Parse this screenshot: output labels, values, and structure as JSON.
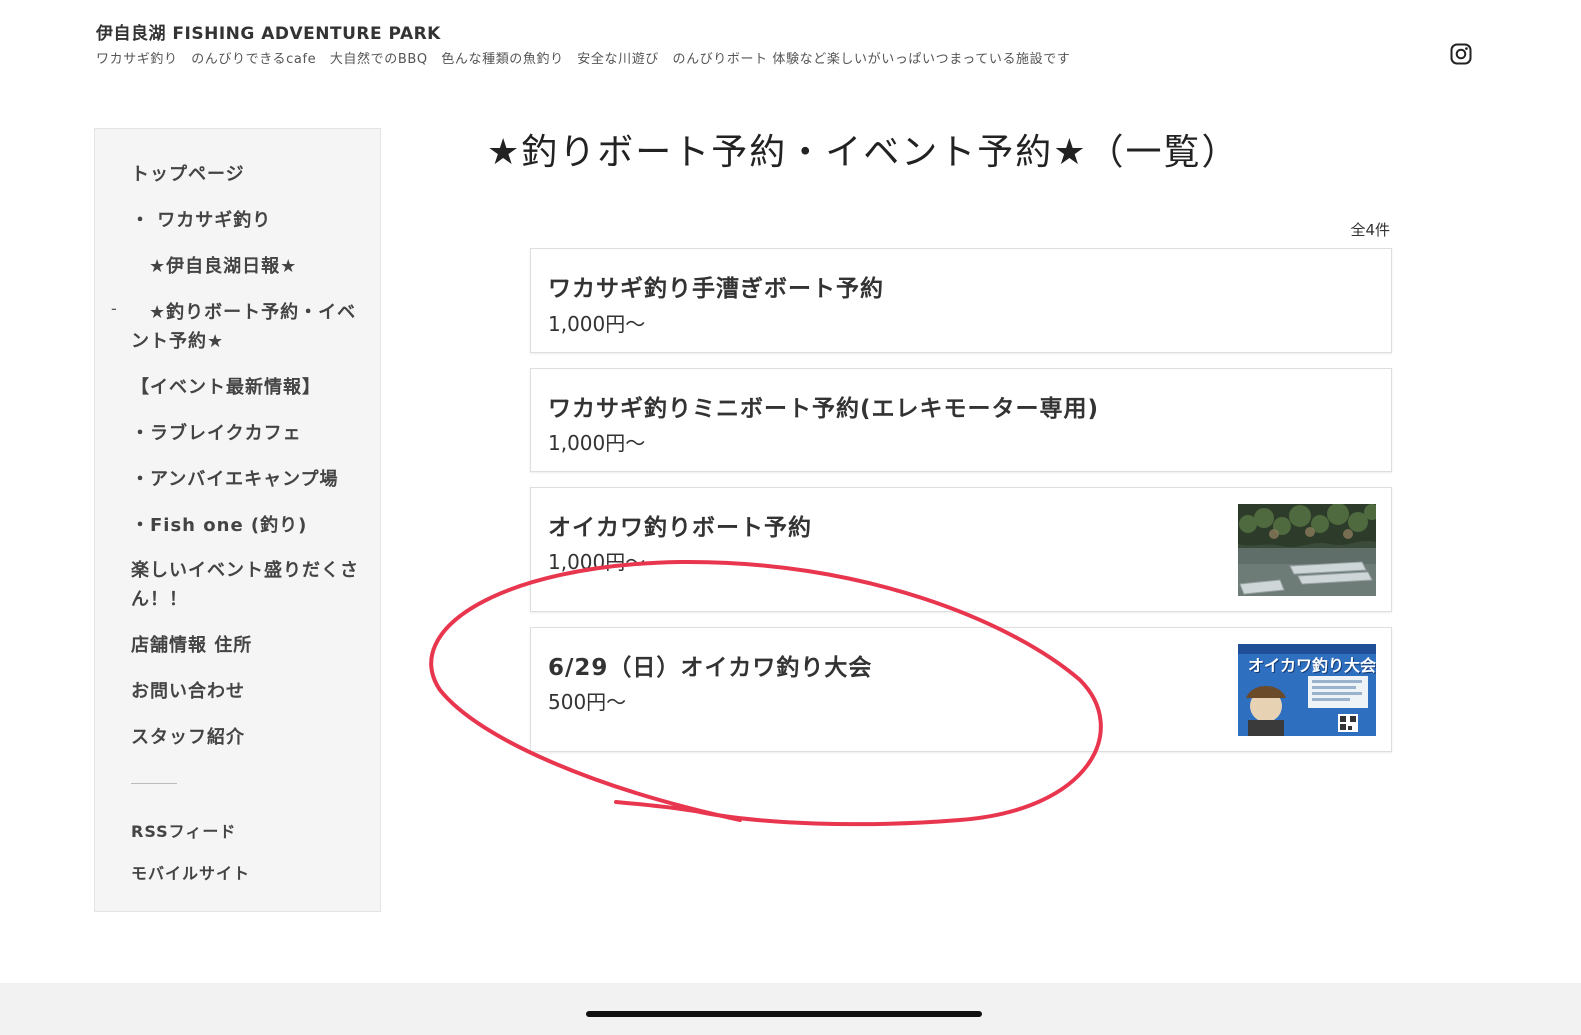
{
  "header": {
    "site_title": "伊自良湖 FISHING ADVENTURE PARK",
    "tagline": "ワカサギ釣り　のんびりできるcafe　大自然でのBBQ　色んな種類の魚釣り　安全な川遊び　のんびりボート 体験など楽しいがいっぱいつまっている施設です",
    "social_icon": "instagram-icon"
  },
  "sidebar": {
    "items": [
      {
        "label": "トップページ"
      },
      {
        "label": "・ ワカサギ釣り"
      },
      {
        "label": "★伊自良湖日報★"
      },
      {
        "label_line1": "★釣りボート予約・イベ",
        "label_line2": "ント予約★",
        "dash": "-"
      },
      {
        "label": "【イベント最新情報】"
      },
      {
        "label": "・ラブレイクカフェ"
      },
      {
        "label": "・アンバイエキャンプ場"
      },
      {
        "label": "・Fish one (釣り)"
      },
      {
        "label_line1": "楽しいイベント盛りだくさ",
        "label_line2": "ん！！"
      },
      {
        "label": "店舗情報 住所"
      },
      {
        "label": "お問い合わせ"
      },
      {
        "label": "スタッフ紹介"
      }
    ],
    "footer_links": [
      {
        "label": "RSSフィード"
      },
      {
        "label": "モバイルサイト"
      }
    ]
  },
  "main": {
    "title": "★釣りボート予約・イベント予約★（一覧）",
    "count": "全4件",
    "products": [
      {
        "name": "ワカサギ釣り手漕ぎボート予約",
        "price": "1,000円〜"
      },
      {
        "name": "ワカサギ釣りミニボート予約(エレキモーター専用)",
        "price": "1,000円〜"
      },
      {
        "name": "オイカワ釣りボート予約",
        "price": "1,000円〜",
        "thumbnail": "boats-on-lake-photo"
      },
      {
        "name": "6/29（日）オイカワ釣り大会",
        "price": "500円〜",
        "thumbnail": "tournament-poster",
        "thumbnail_text": "オイカワ釣り大会"
      }
    ]
  },
  "colors": {
    "annotation": "#e8364f",
    "sidebar_bg": "#f5f5f5",
    "poster_bg": "#2f6fc0"
  }
}
